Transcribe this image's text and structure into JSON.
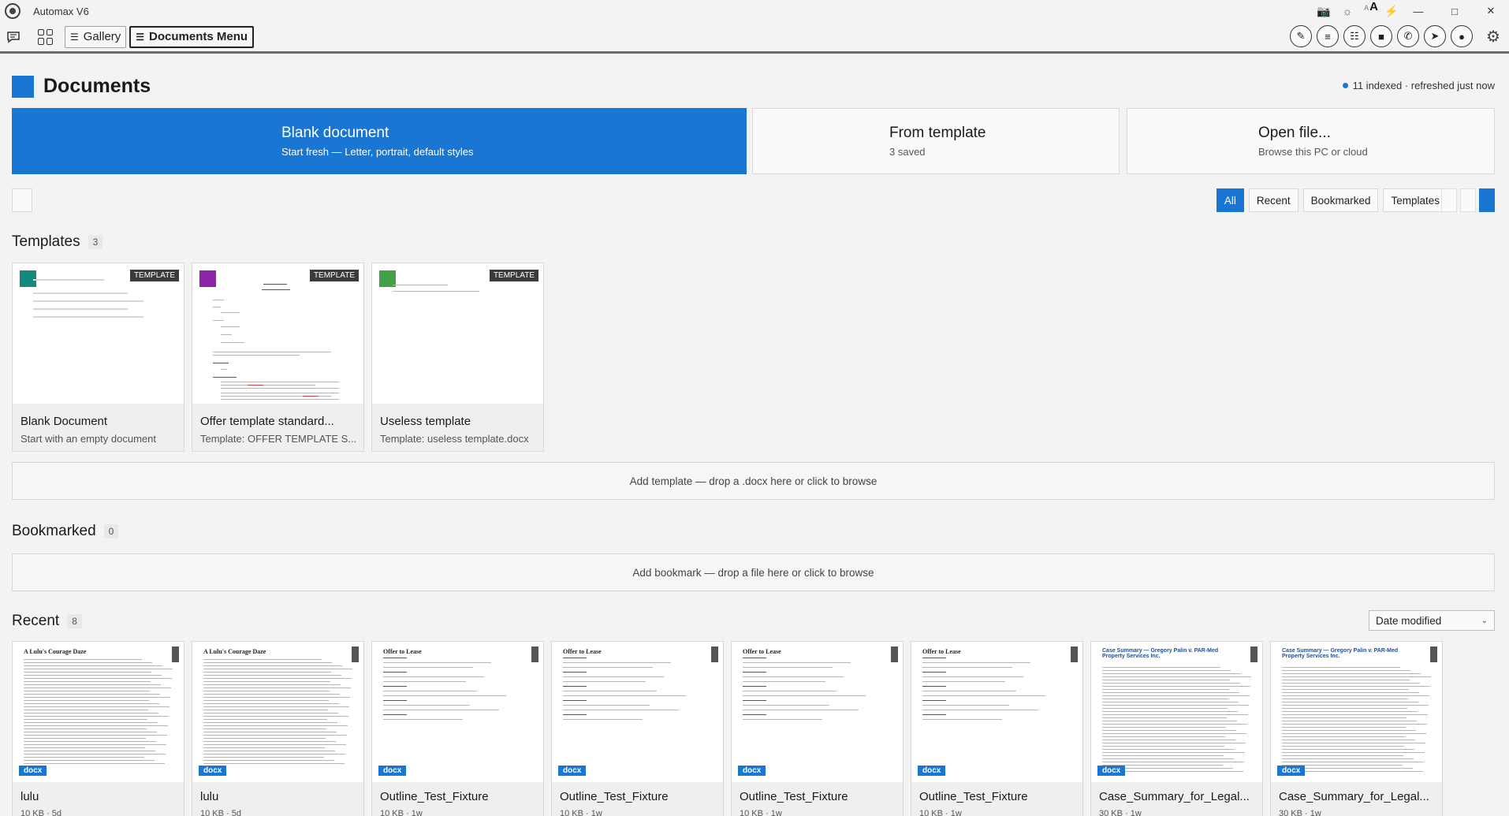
{
  "app": {
    "title": "Automax V6",
    "logo_icon": "automax-logo-icon",
    "titlebar_icons": [
      "camera-icon",
      "brightness-icon",
      "font-size-toggle",
      "lightning-icon"
    ],
    "font_toggle": {
      "small": "A",
      "big": "A"
    },
    "window_controls": [
      "minimize-icon",
      "maximize-icon",
      "close-icon"
    ]
  },
  "toolbar": {
    "left_icons": [
      "chat-icon",
      "grid-icon"
    ],
    "tabs": [
      {
        "label": "Gallery",
        "icon": "menu-lines-icon",
        "active": false
      },
      {
        "label": "Documents Menu",
        "icon": "menu-lines-icon",
        "active": true
      }
    ],
    "right_icons": [
      "signature-icon",
      "resume-icon",
      "database-icon",
      "folder-icon",
      "phone-icon",
      "send-icon",
      "message-icon"
    ],
    "settings_icon": "gear-icon"
  },
  "page": {
    "title": "Documents",
    "accent_color": "#1976d2",
    "index_status": "11 indexed · refreshed just now"
  },
  "actions": [
    {
      "title": "Blank document",
      "subtitle": "Start fresh — Letter, portrait, default styles",
      "primary": true
    },
    {
      "title": "From template",
      "subtitle": "3 saved",
      "primary": false
    },
    {
      "title": "Open file...",
      "subtitle": "Browse this PC or cloud",
      "primary": false
    }
  ],
  "filters": {
    "options": [
      "All",
      "Recent",
      "Bookmarked",
      "Templates"
    ],
    "selected": "All"
  },
  "templates": {
    "title": "Templates",
    "count": "3",
    "badge": "TEMPLATE",
    "items": [
      {
        "name": "Blank Document",
        "subtitle": "Start with an empty document",
        "swatch": "#138a7e"
      },
      {
        "name": "Offer template standard...",
        "subtitle": "Template: OFFER TEMPLATE S...",
        "swatch": "#8e24aa"
      },
      {
        "name": "Useless template",
        "subtitle": "Template: useless template.docx",
        "swatch": "#43a047"
      }
    ],
    "dropzone": "Add template — drop a .docx here or click to browse"
  },
  "bookmarked": {
    "title": "Bookmarked",
    "count": "0",
    "dropzone": "Add bookmark — drop a file here or click to browse"
  },
  "recent": {
    "title": "Recent",
    "count": "8",
    "sort": "Date modified",
    "type_badge": "docx",
    "items": [
      {
        "name": "lulu",
        "meta": "10 KB · 5d",
        "kind": "story"
      },
      {
        "name": "lulu",
        "meta": "10 KB · 5d",
        "kind": "story"
      },
      {
        "name": "Outline_Test_Fixture",
        "meta": "10 KB · 1w",
        "kind": "offer"
      },
      {
        "name": "Outline_Test_Fixture",
        "meta": "10 KB · 1w",
        "kind": "offer"
      },
      {
        "name": "Outline_Test_Fixture",
        "meta": "10 KB · 1w",
        "kind": "offer"
      },
      {
        "name": "Outline_Test_Fixture",
        "meta": "10 KB · 1w",
        "kind": "offer"
      },
      {
        "name": "Case_Summary_for_Legal...",
        "meta": "30 KB · 1w",
        "kind": "case"
      },
      {
        "name": "Case_Summary_for_Legal...",
        "meta": "30 KB · 1w",
        "kind": "case"
      }
    ],
    "thumb_text": {
      "story_title": "A Lulu's Courage Daze",
      "offer_title": "Offer to Lease",
      "case_title": "Case Summary — Gregory Palin v. PAR-Med Property Services Inc."
    }
  }
}
